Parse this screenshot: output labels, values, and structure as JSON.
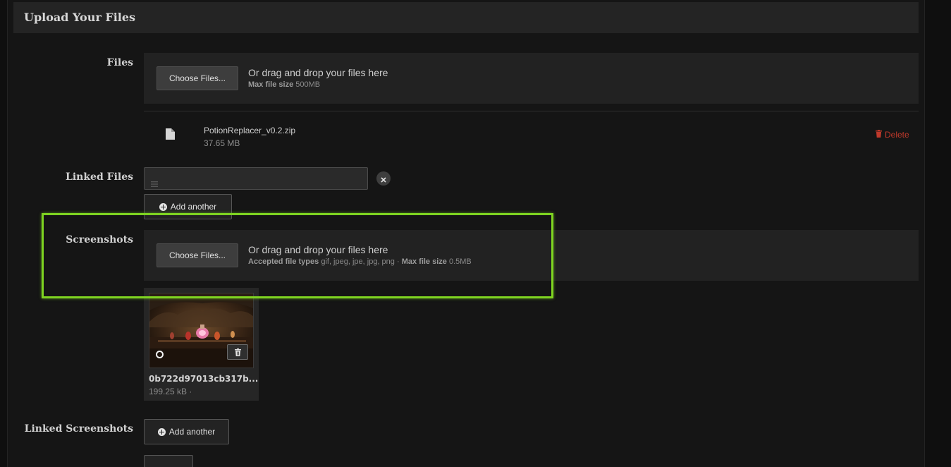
{
  "section": {
    "title": "Upload Your Files"
  },
  "files": {
    "label": "Files",
    "choose_button": "Choose Files...",
    "drop_text": "Or drag and drop your files here",
    "max_size_label": "Max file size",
    "max_size_value": "500MB"
  },
  "uploaded_file": {
    "name": "PotionReplacer_v0.2.zip",
    "size": "37.65 MB",
    "delete_label": "Delete"
  },
  "linked_files": {
    "label": "Linked Files",
    "input_value": "",
    "add_button": "Add another"
  },
  "screenshots": {
    "label": "Screenshots",
    "choose_button": "Choose Files...",
    "drop_text": "Or drag and drop your files here",
    "accepted_label": "Accepted file types",
    "accepted_value": "gif, jpeg, jpe, jpg, png",
    "separator": "·",
    "max_size_label": "Max file size",
    "max_size_value": "0.5MB",
    "thumbnail": {
      "name": "0b722d97013cb317b...",
      "size": "199.25 kB ·"
    }
  },
  "linked_screenshots": {
    "label": "Linked Screenshots",
    "add_button": "Add another"
  },
  "colors": {
    "highlight": "#7ed321",
    "delete": "#c0392b"
  }
}
